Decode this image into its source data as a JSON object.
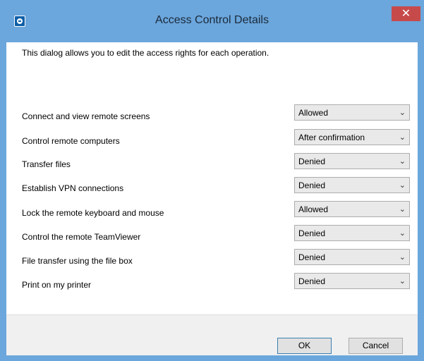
{
  "window": {
    "title": "Access Control Details",
    "close_glyph": "✕",
    "app_icon": "teamviewer-icon",
    "accent_color": "#6ba6dc",
    "close_color": "#c74a4a"
  },
  "dialog": {
    "description": "This dialog allows you to edit the access rights for each operation.",
    "rows": [
      {
        "label": "Connect and view remote screens",
        "value": "Allowed"
      },
      {
        "label": "Control remote computers",
        "value": "After confirmation"
      },
      {
        "label": "Transfer files",
        "value": "Denied"
      },
      {
        "label": "Establish VPN connections",
        "value": "Denied"
      },
      {
        "label": "Lock the remote keyboard and mouse",
        "value": "Allowed"
      },
      {
        "label": "Control the remote TeamViewer",
        "value": "Denied"
      },
      {
        "label": "File transfer using the file box",
        "value": "Denied"
      },
      {
        "label": "Print on my printer",
        "value": "Denied"
      }
    ]
  },
  "footer": {
    "ok_label": "OK",
    "cancel_label": "Cancel"
  },
  "chevron_glyph": "⌄"
}
